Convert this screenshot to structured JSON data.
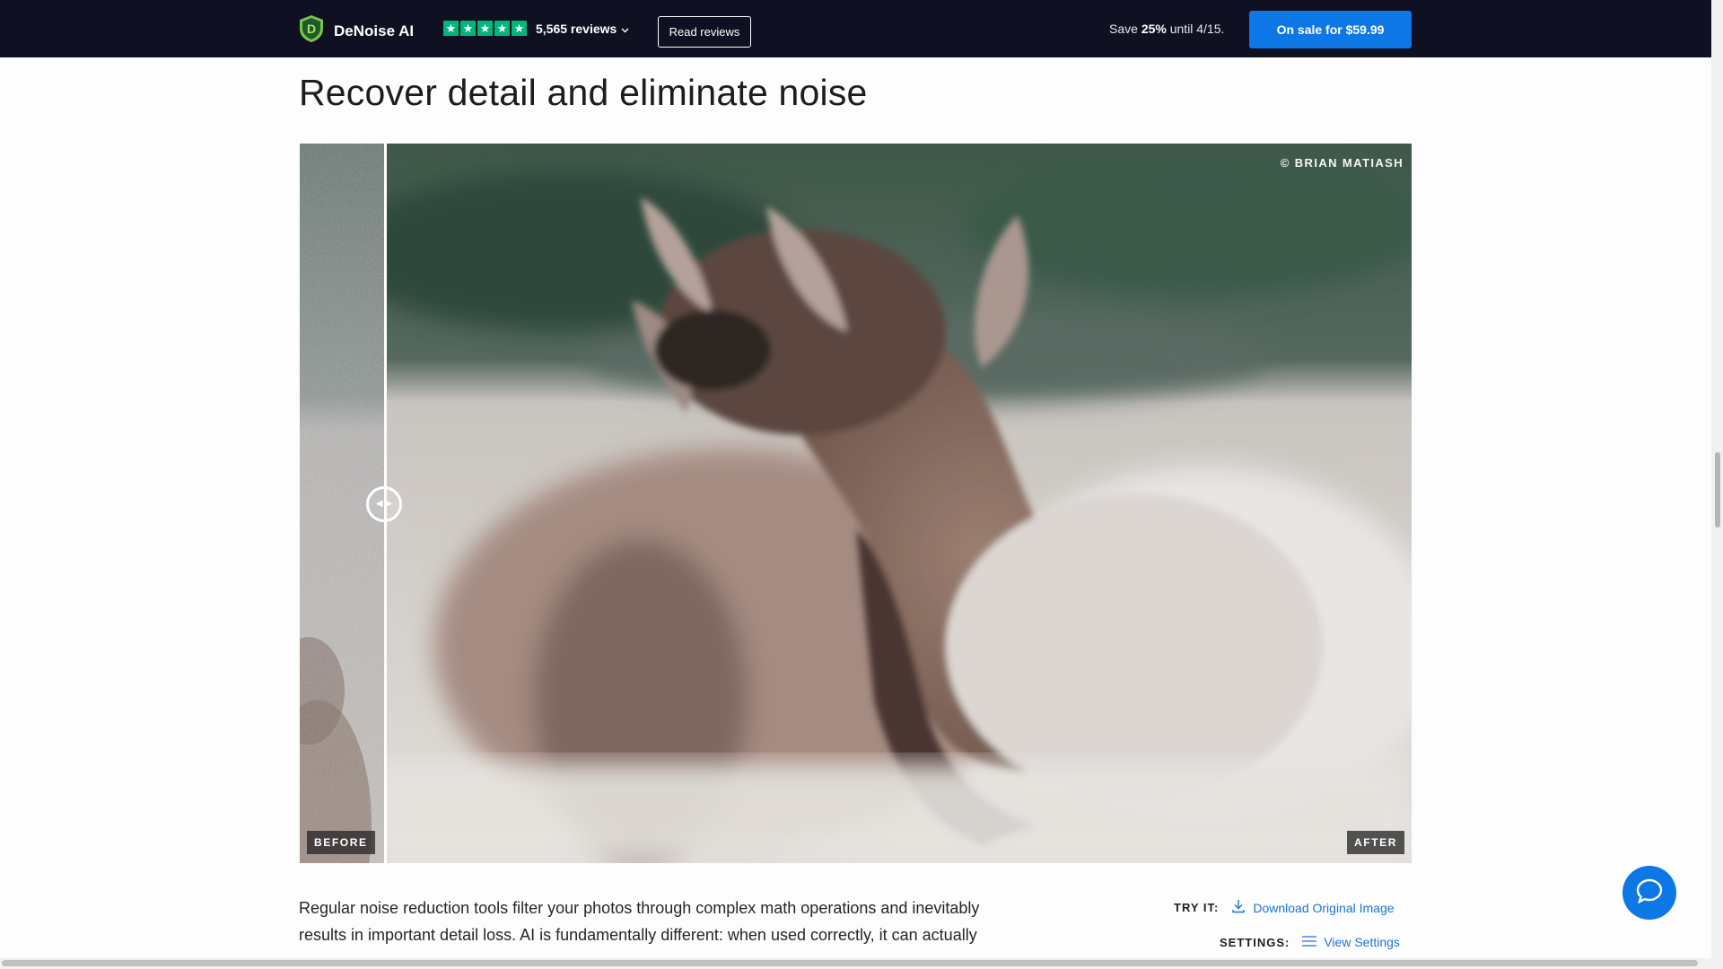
{
  "header": {
    "brand_name": "DeNoise AI",
    "reviews_label": "5,565 reviews",
    "read_reviews_label": "Read reviews",
    "save_prefix": "Save",
    "save_percent": "25%",
    "save_suffix": "until 4/15.",
    "sale_button_label": "On sale for $59.99",
    "star_rating": 5,
    "star_color": "#00b67a",
    "accent_color": "#0d77e6"
  },
  "main": {
    "title": "Recover detail and eliminate noise",
    "comparison": {
      "credit": "© BRIAN MATIASH",
      "before_label": "BEFORE",
      "after_label": "AFTER",
      "slider_position_percent": 7.6
    },
    "description": "Regular noise reduction tools filter your photos through complex math operations and inevitably results in important detail loss. AI is fundamentally different: when used correctly, it can actually",
    "try_it_label": "TRY IT:",
    "download_label": "Download Original Image",
    "settings_label": "SETTINGS:",
    "view_settings_label": "View Settings"
  },
  "icons": {
    "brand_logo": "shield-d-logo",
    "help": "chat-bubble-icon",
    "download": "download-icon",
    "settings": "list-icon"
  }
}
